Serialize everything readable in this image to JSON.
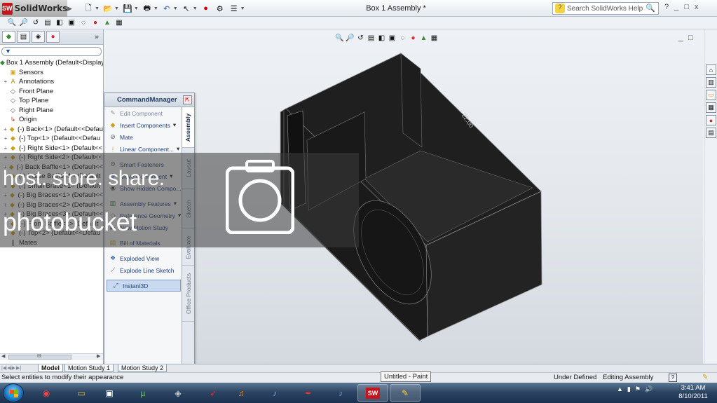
{
  "app": {
    "brand": "SolidWorks",
    "window_title": "Box 1 Assembly *",
    "search_placeholder": "Search SolidWorks Help",
    "help_glyph": "?",
    "window_controls": [
      "_",
      "□",
      "x"
    ]
  },
  "main_toolbar_icons": [
    "new-document-icon",
    "open-folder-icon",
    "save-icon",
    "print-icon",
    "undo-icon",
    "select-arrow-icon",
    "traffic-light-icon",
    "options-icon",
    "display-pane-icon"
  ],
  "feature_tree": {
    "more_glyph": "»",
    "filter_glyph": "▼",
    "nodes": [
      {
        "label": "Box 1 Assembly  (Default<Display",
        "icon": "assembly-icon",
        "indent": 0,
        "expander": ""
      },
      {
        "label": "Sensors",
        "icon": "sensors-folder-icon",
        "indent": 1,
        "expander": ""
      },
      {
        "label": "Annotations",
        "icon": "annotations-icon",
        "indent": 1,
        "expander": "+"
      },
      {
        "label": "Front Plane",
        "icon": "plane-icon",
        "indent": 1,
        "expander": ""
      },
      {
        "label": "Top Plane",
        "icon": "plane-icon",
        "indent": 1,
        "expander": ""
      },
      {
        "label": "Right Plane",
        "icon": "plane-icon",
        "indent": 1,
        "expander": ""
      },
      {
        "label": "Origin",
        "icon": "origin-icon",
        "indent": 1,
        "expander": ""
      },
      {
        "label": "(-) Back<1> (Default<<Defau",
        "icon": "part-icon",
        "indent": 1,
        "expander": "+"
      },
      {
        "label": "(-) Top<1> (Default<<Defau",
        "icon": "part-icon",
        "indent": 1,
        "expander": "+"
      },
      {
        "label": "(-) Right Side<1> (Default<<",
        "icon": "part-icon",
        "indent": 1,
        "expander": "+"
      },
      {
        "label": "(-) Right Side<2> (Default<<",
        "icon": "part-icon",
        "indent": 1,
        "expander": "+"
      },
      {
        "label": "(-) Back Baffle<1> (Default<<",
        "icon": "part-icon",
        "indent": 1,
        "expander": "+"
      },
      {
        "label": "(-) Inside Baffle<1> (Default",
        "icon": "part-icon",
        "indent": 1,
        "expander": "+"
      },
      {
        "label": "(-) Small Brace<1> (Default",
        "icon": "part-icon",
        "indent": 1,
        "expander": "+"
      },
      {
        "label": "(-) Big Braces<1> (Default<<",
        "icon": "part-icon",
        "indent": 1,
        "expander": "+"
      },
      {
        "label": "(-) Big Braces<2> (Default<<",
        "icon": "part-icon",
        "indent": 1,
        "expander": "+"
      },
      {
        "label": "(-) Big Braces<3> (Default<<",
        "icon": "part-icon",
        "indent": 1,
        "expander": "+"
      },
      {
        "label": "(-) Front Baffle<1> (Default",
        "icon": "part-icon",
        "indent": 1,
        "expander": "+"
      },
      {
        "label": "(-) Top<2> (Default<<Defau",
        "icon": "part-icon",
        "indent": 1,
        "expander": "+"
      },
      {
        "label": "Mates",
        "icon": "mates-icon",
        "indent": 1,
        "expander": ""
      }
    ],
    "scroll_glyph": "III"
  },
  "command_manager": {
    "title": "CommandManager",
    "items": [
      {
        "label": "Edit Component",
        "icon": "edit-component-icon",
        "dim": true,
        "dropdown": false
      },
      {
        "label": "Insert Components",
        "icon": "insert-components-icon",
        "dim": false,
        "dropdown": true
      },
      {
        "label": "Mate",
        "icon": "mate-icon",
        "dim": false,
        "dropdown": false
      },
      {
        "label": "Linear Component...",
        "icon": "linear-pattern-icon",
        "dim": false,
        "dropdown": true
      },
      {
        "label": "Smart Fasteners",
        "icon": "smart-fasteners-icon",
        "dim": false,
        "dropdown": false
      },
      {
        "label": "Move Component",
        "icon": "move-component-icon",
        "dim": false,
        "dropdown": true
      },
      {
        "label": "Show Hidden Compo...",
        "icon": "show-hidden-icon",
        "dim": false,
        "dropdown": false
      },
      {
        "label": "Assembly Features",
        "icon": "assembly-features-icon",
        "dim": false,
        "dropdown": true
      },
      {
        "label": "Reference Geometry",
        "icon": "reference-geometry-icon",
        "dim": false,
        "dropdown": true
      },
      {
        "label": "New Motion Study",
        "icon": "new-motion-study-icon",
        "dim": false,
        "dropdown": false
      },
      {
        "label": "Bill of Materials",
        "icon": "bill-of-materials-icon",
        "dim": false,
        "dropdown": false
      },
      {
        "label": "Exploded View",
        "icon": "exploded-view-icon",
        "dim": false,
        "dropdown": false
      },
      {
        "label": "Explode Line Sketch",
        "icon": "explode-line-sketch-icon",
        "dim": false,
        "dropdown": false
      },
      {
        "label": "Instant3D",
        "icon": "instant3d-icon",
        "dim": false,
        "dropdown": false,
        "selected": true
      }
    ],
    "tabs": [
      "Assembly",
      "Layout",
      "Sketch",
      "Evaluate",
      "Office Products"
    ]
  },
  "viewport": {
    "heads_up_toolbar": [
      "zoom-to-fit-icon",
      "zoom-area-icon",
      "previous-view-icon",
      "section-view-icon",
      "view-orientation-icon",
      "display-style-icon",
      "hide-show-icon",
      "edit-appearance-icon",
      "apply-scene-icon",
      "view-settings-icon"
    ],
    "model_dimension_text": "22.00"
  },
  "task_pane_icons": [
    "home-icon",
    "design-library-icon",
    "file-explorer-icon",
    "view-palette-icon",
    "appearances-icon",
    "custom-properties-icon"
  ],
  "bottom_tabs": {
    "tabs": [
      "Model",
      "Motion Study 1",
      "Motion Study 2"
    ]
  },
  "status_bar": {
    "message": "Select entities to modify their appearance",
    "definition": "Under Defined",
    "mode": "Editing Assembly",
    "help_glyph": "?"
  },
  "tooltip": "Untitled - Paint",
  "watermark": {
    "line1": "host. store. share.",
    "line2": "photobucket"
  },
  "taskbar": {
    "apps": [
      {
        "name": "chrome",
        "icon": "chrome-icon",
        "active": false
      },
      {
        "name": "explorer",
        "icon": "folder-icon",
        "active": false
      },
      {
        "name": "media",
        "icon": "media-icon",
        "active": false
      },
      {
        "name": "utorrent",
        "icon": "utorrent-icon",
        "active": false
      },
      {
        "name": "game",
        "icon": "game-icon",
        "active": false
      },
      {
        "name": "rocket",
        "icon": "rocket-icon",
        "active": false
      },
      {
        "name": "sound",
        "icon": "sound-app-icon",
        "active": false
      },
      {
        "name": "itunes",
        "icon": "itunes-icon",
        "active": false
      },
      {
        "name": "pen",
        "icon": "pen-icon",
        "active": false
      },
      {
        "name": "itunes2",
        "icon": "itunes-icon",
        "active": false
      },
      {
        "name": "solidworks",
        "icon": "solidworks-icon",
        "active": true
      },
      {
        "name": "paint",
        "icon": "paint-icon",
        "active": true
      }
    ],
    "time": "3:41 AM",
    "date": "8/10/2011"
  },
  "colors": {
    "accent": "#1d3e7a",
    "model_fill": "#1c1c1c",
    "taskbar": "#1c3150",
    "brand_red": "#c4161c"
  }
}
